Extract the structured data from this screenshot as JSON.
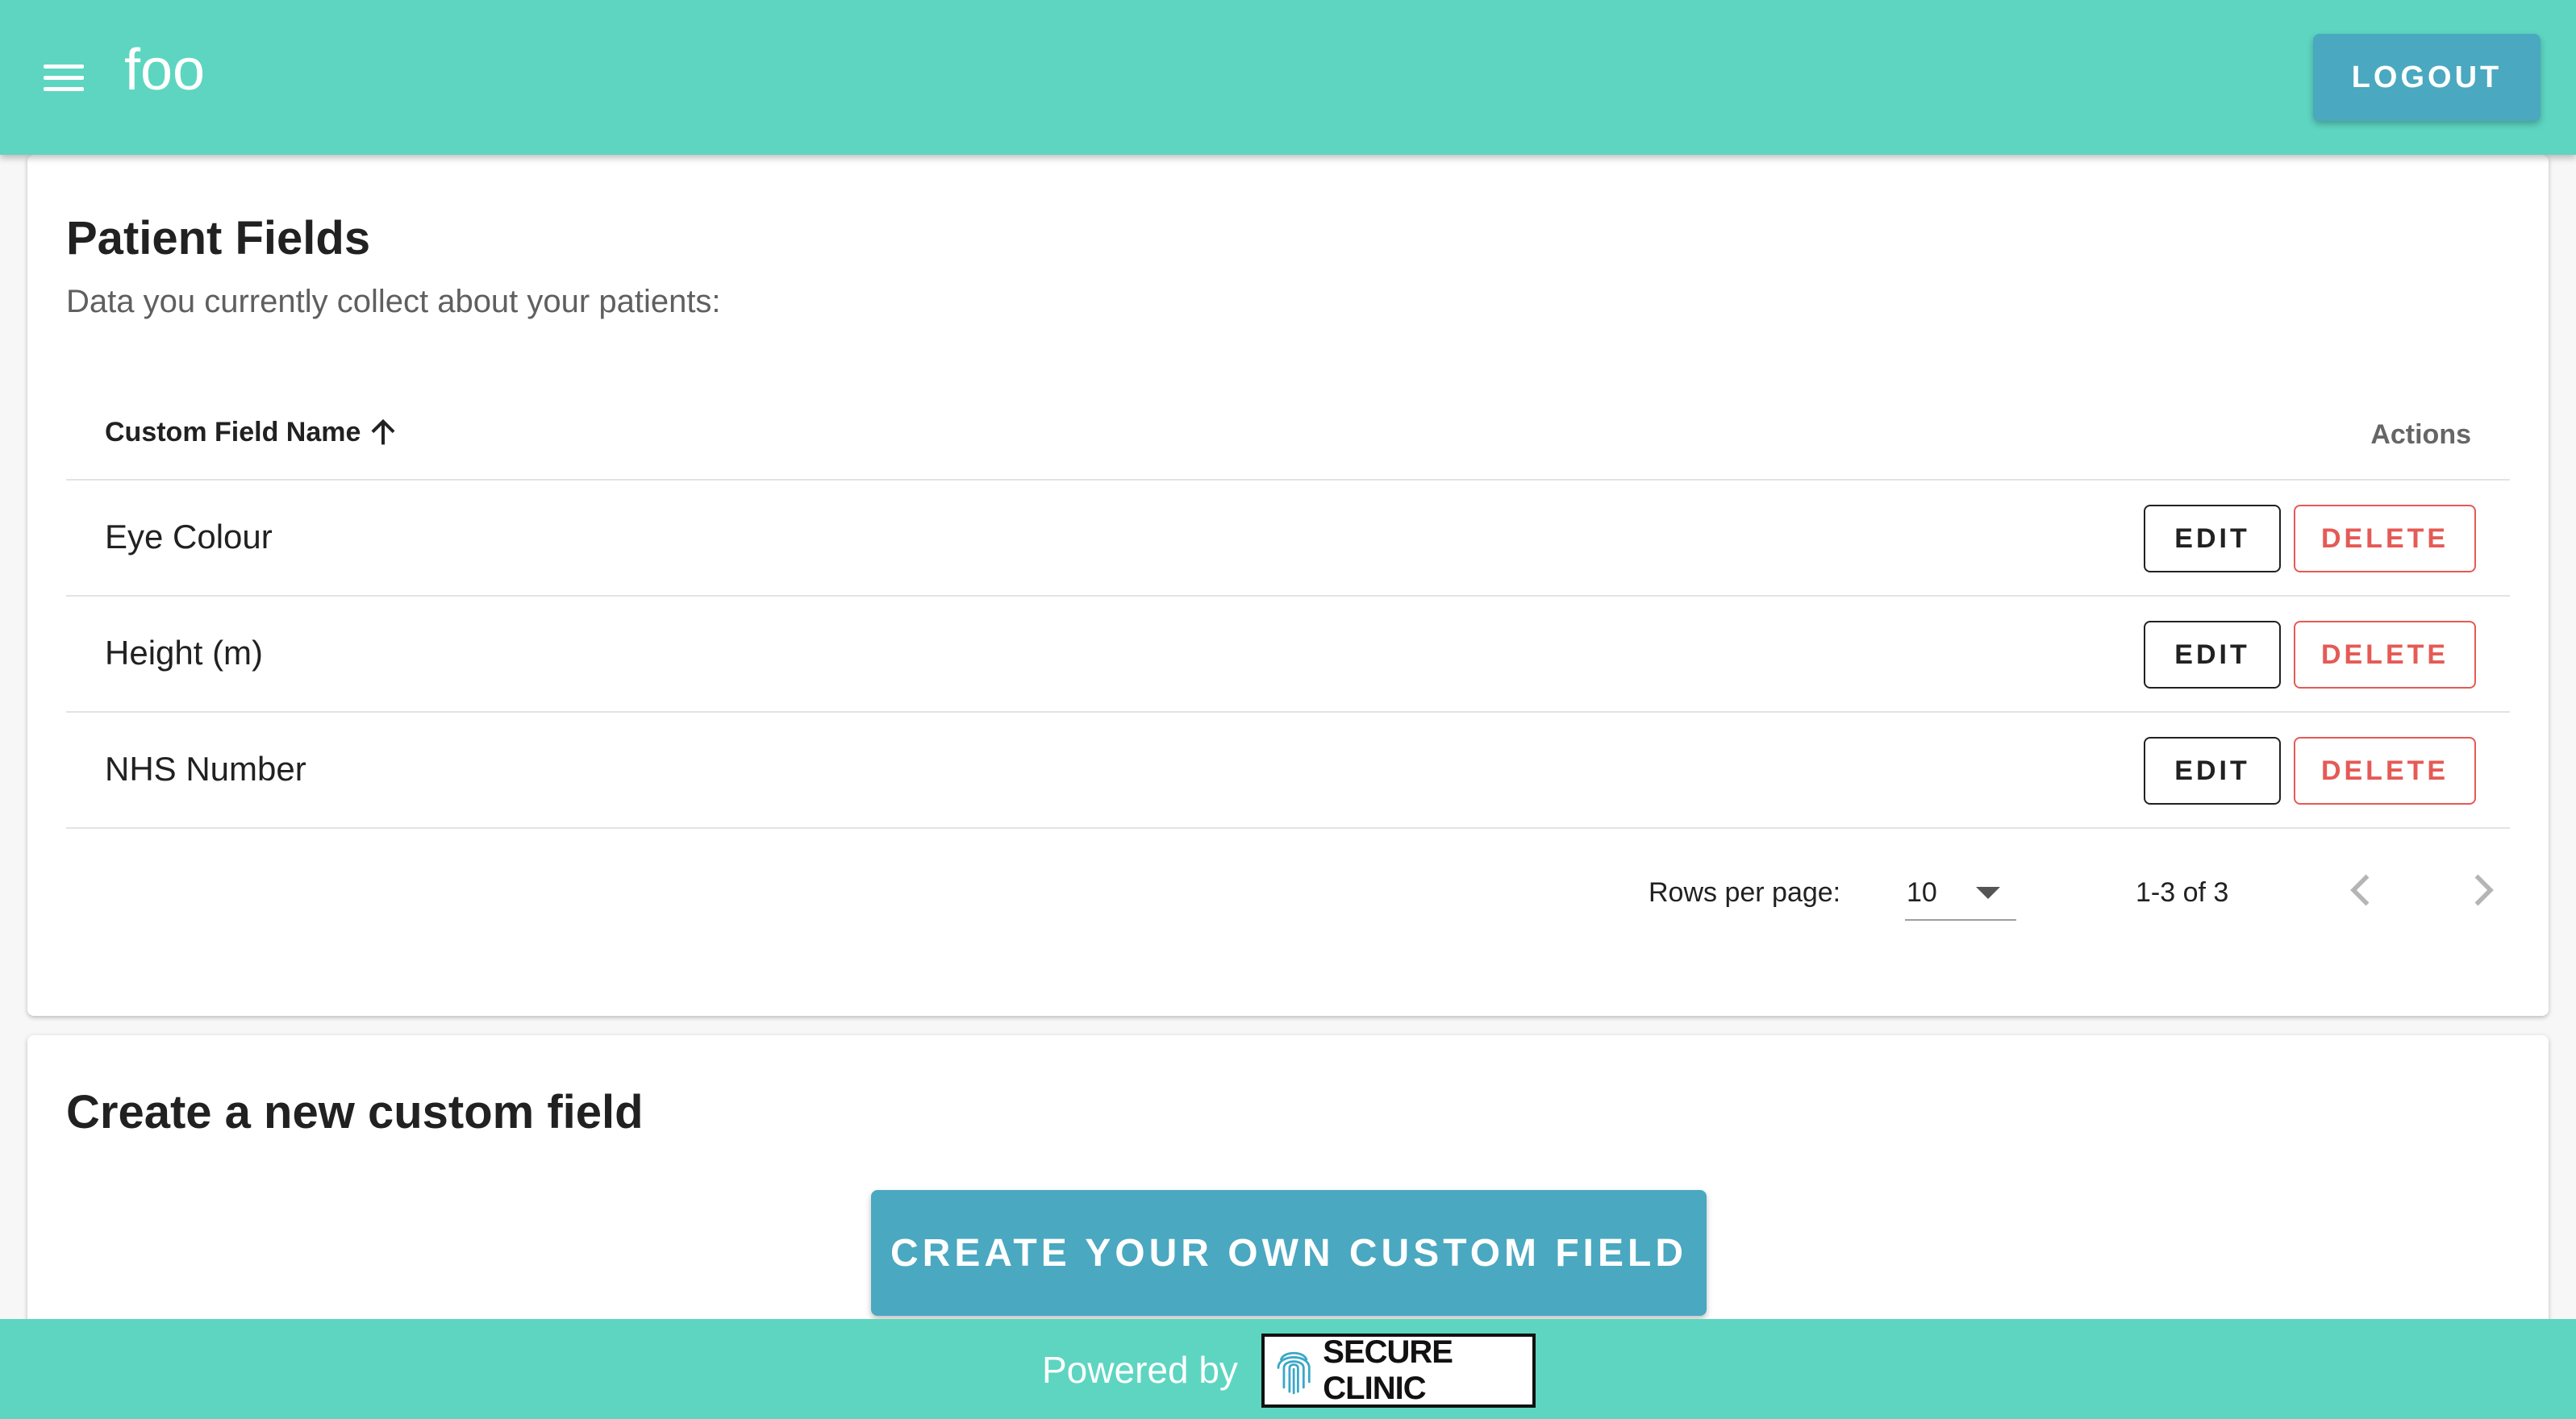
{
  "appbar": {
    "title": "foo",
    "logout_label": "LOGOUT"
  },
  "patient_fields": {
    "title": "Patient Fields",
    "subtitle": "Data you currently collect about your patients:",
    "columns": {
      "name": "Custom Field Name",
      "actions": "Actions"
    },
    "sort": "ascending",
    "rows": [
      {
        "name": "Eye Colour",
        "edit_label": "EDIT",
        "delete_label": "DELETE"
      },
      {
        "name": "Height (m)",
        "edit_label": "EDIT",
        "delete_label": "DELETE"
      },
      {
        "name": "NHS Number",
        "edit_label": "EDIT",
        "delete_label": "DELETE"
      }
    ],
    "pagination": {
      "rows_per_page_label": "Rows per page:",
      "rows_per_page": "10",
      "range": "1-3 of 3"
    }
  },
  "create": {
    "title": "Create a new custom field",
    "button_label": "CREATE YOUR OWN CUSTOM FIELD"
  },
  "footer": {
    "powered_by": "Powered by",
    "logo_text": "SECURE CLINIC"
  },
  "colors": {
    "appbar": "#5dd5c1",
    "primary_button": "#4aa8c0",
    "delete": "#e55a55"
  },
  "icons": {
    "menu": "menu-icon",
    "sort": "arrow-up-icon",
    "select": "caret-down-icon",
    "prev": "chevron-left-icon",
    "next": "chevron-right-icon",
    "logo": "fingerprint-icon"
  }
}
